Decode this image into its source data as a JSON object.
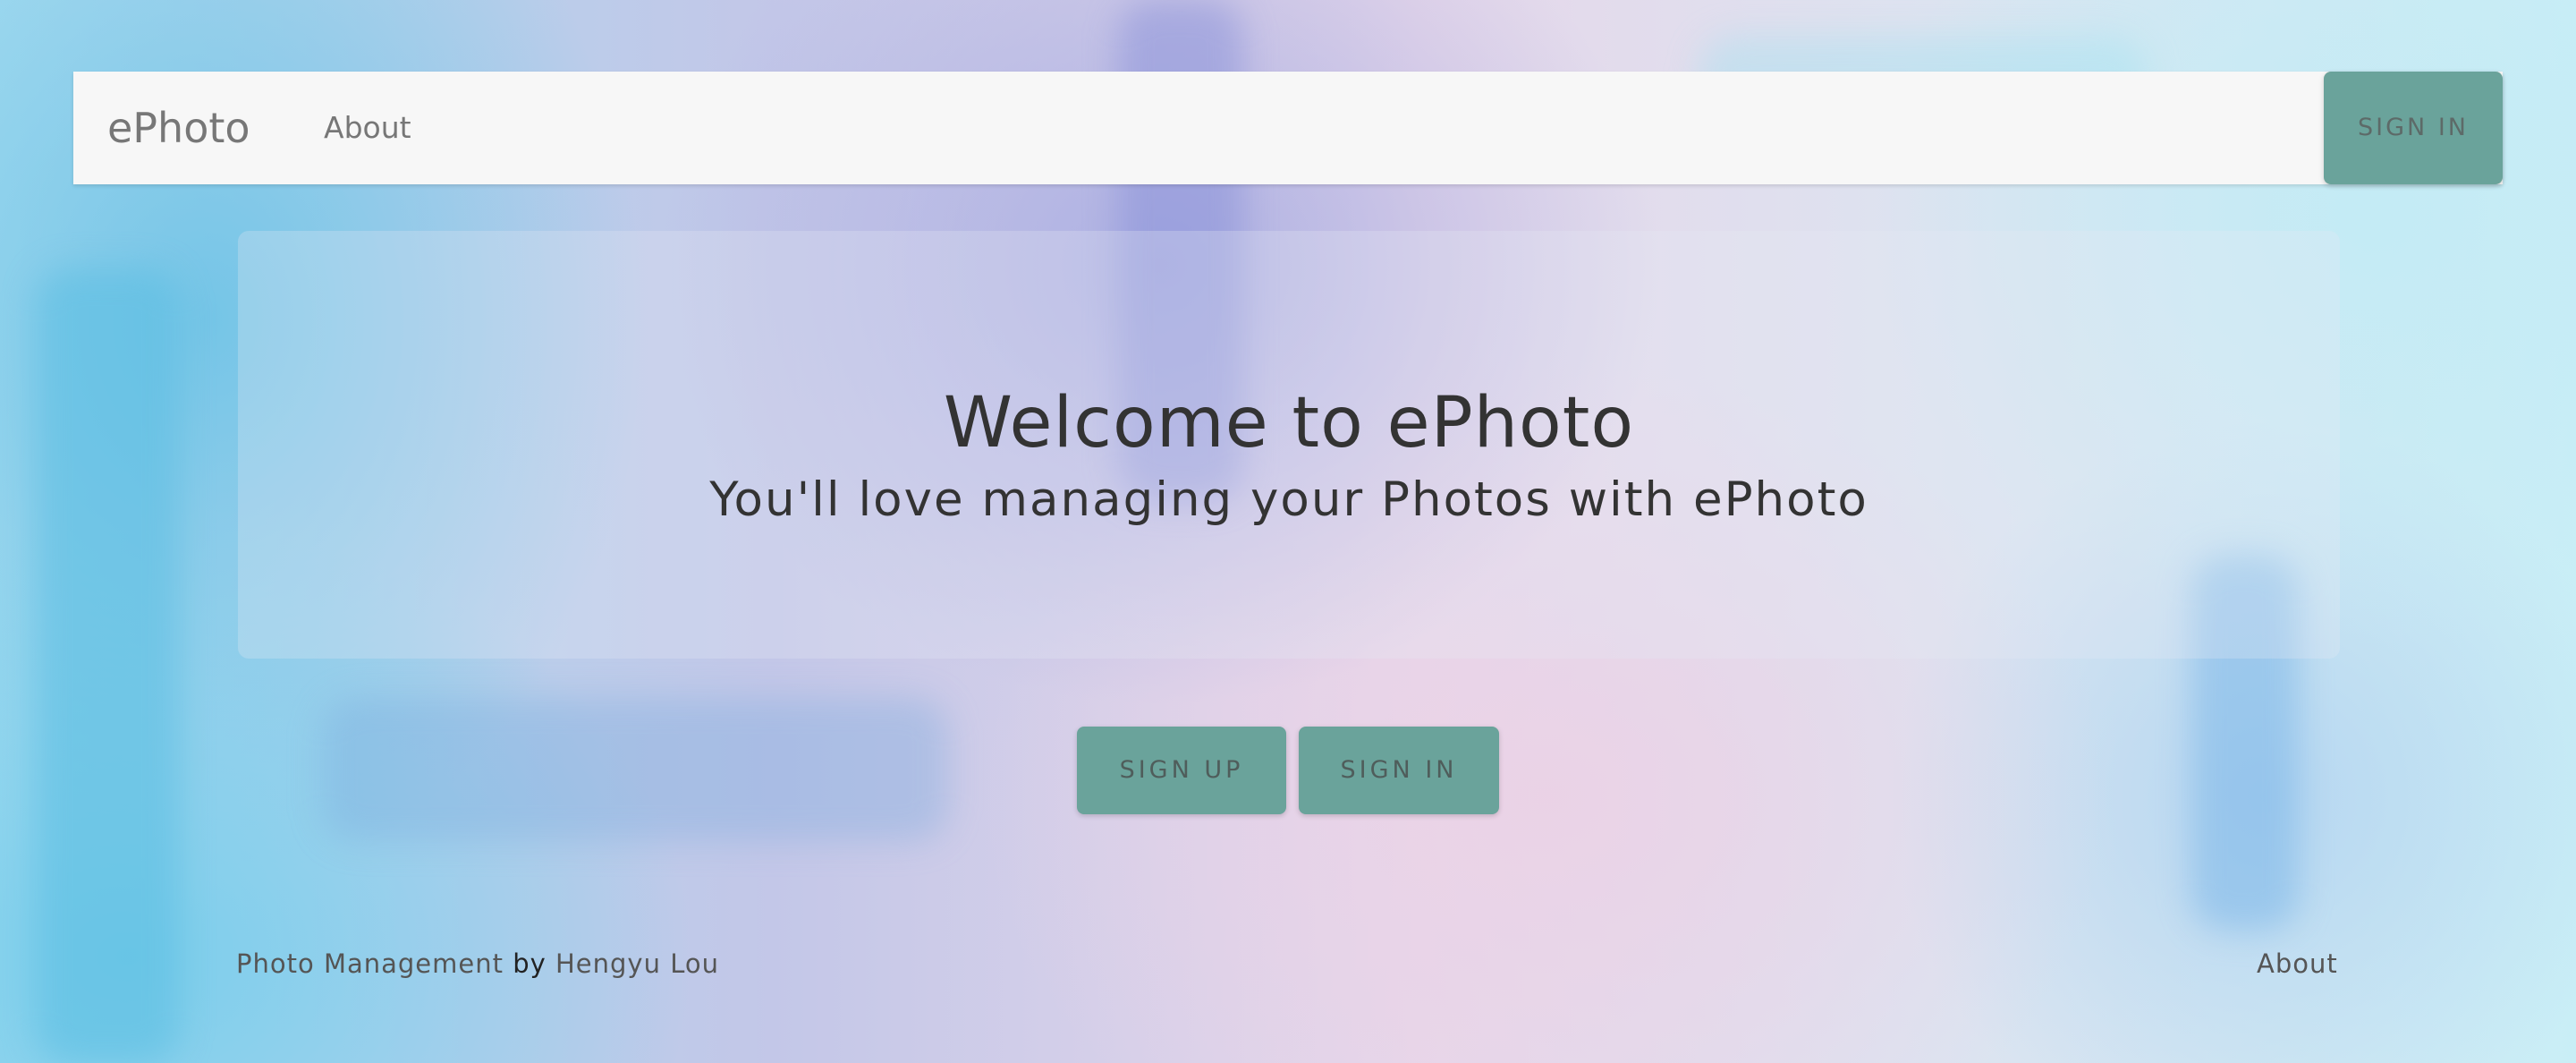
{
  "navbar": {
    "brand": "ePhoto",
    "links": [
      {
        "label": "About"
      }
    ],
    "sign_in_label": "SIGN IN"
  },
  "hero": {
    "title": "Welcome to ePhoto",
    "subtitle": "You'll love managing your Photos with ePhoto"
  },
  "actions": {
    "sign_up_label": "SIGN UP",
    "sign_in_label": "SIGN IN"
  },
  "footer": {
    "app_link": "Photo Management",
    "by_text": "by",
    "author_link": "Hengyu Lou",
    "about_link": "About"
  },
  "colors": {
    "accent": "#6aa39b",
    "navbar_bg": "#f7f7f7",
    "text_dark": "#333333",
    "text_muted": "#777777"
  }
}
